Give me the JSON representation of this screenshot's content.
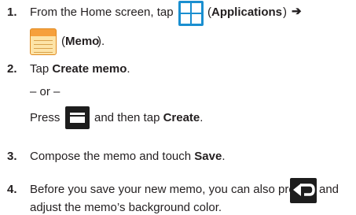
{
  "steps": [
    {
      "num": "1.",
      "parts": {
        "a": "From the Home screen, tap",
        "b": "(",
        "c": "Applications",
        "d": ")",
        "arrow": "➔",
        "e": "(",
        "f": "Memo",
        "g": ")."
      }
    },
    {
      "num": "2.",
      "parts": {
        "a": "Tap ",
        "b": "Create memo",
        "c": "."
      }
    },
    {
      "or": "– or –"
    },
    {
      "parts": {
        "a": "Press",
        "b": "and then tap ",
        "c": "Create",
        "d": "."
      }
    },
    {
      "num": "3.",
      "parts": {
        "a": "Compose the memo and touch ",
        "b": "Save",
        "c": "."
      }
    },
    {
      "num": "4.",
      "parts": {
        "a": "Before you save your new memo, you can also press",
        "b": "and",
        "c": "adjust the memo’s background color."
      }
    }
  ],
  "icons": {
    "applications": "applications-icon",
    "memo": "memo-icon",
    "menu": "menu-icon",
    "back": "back-icon"
  }
}
